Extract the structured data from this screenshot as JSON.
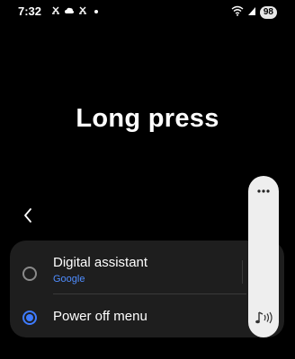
{
  "status_bar": {
    "time": "7:32",
    "battery": "98",
    "icons_left": [
      "missed-call-icon",
      "cloud-icon",
      "missed-call-icon",
      "dot-icon"
    ],
    "icons_right": [
      "wifi-icon",
      "signal-icon",
      "battery-icon"
    ]
  },
  "page": {
    "title": "Long press"
  },
  "options": [
    {
      "label": "Digital assistant",
      "sub": "Google",
      "selected": false
    },
    {
      "label": "Power off menu",
      "sub": "",
      "selected": true
    }
  ],
  "floating_panel": {
    "more_icon": "more-dots-icon",
    "sound_icon": "music-note-sound-icon"
  },
  "colors": {
    "background": "#000000",
    "card": "#1e1e1e",
    "accent": "#3e7bff",
    "sublabel": "#4f8dff",
    "panel": "#eeeeee"
  }
}
